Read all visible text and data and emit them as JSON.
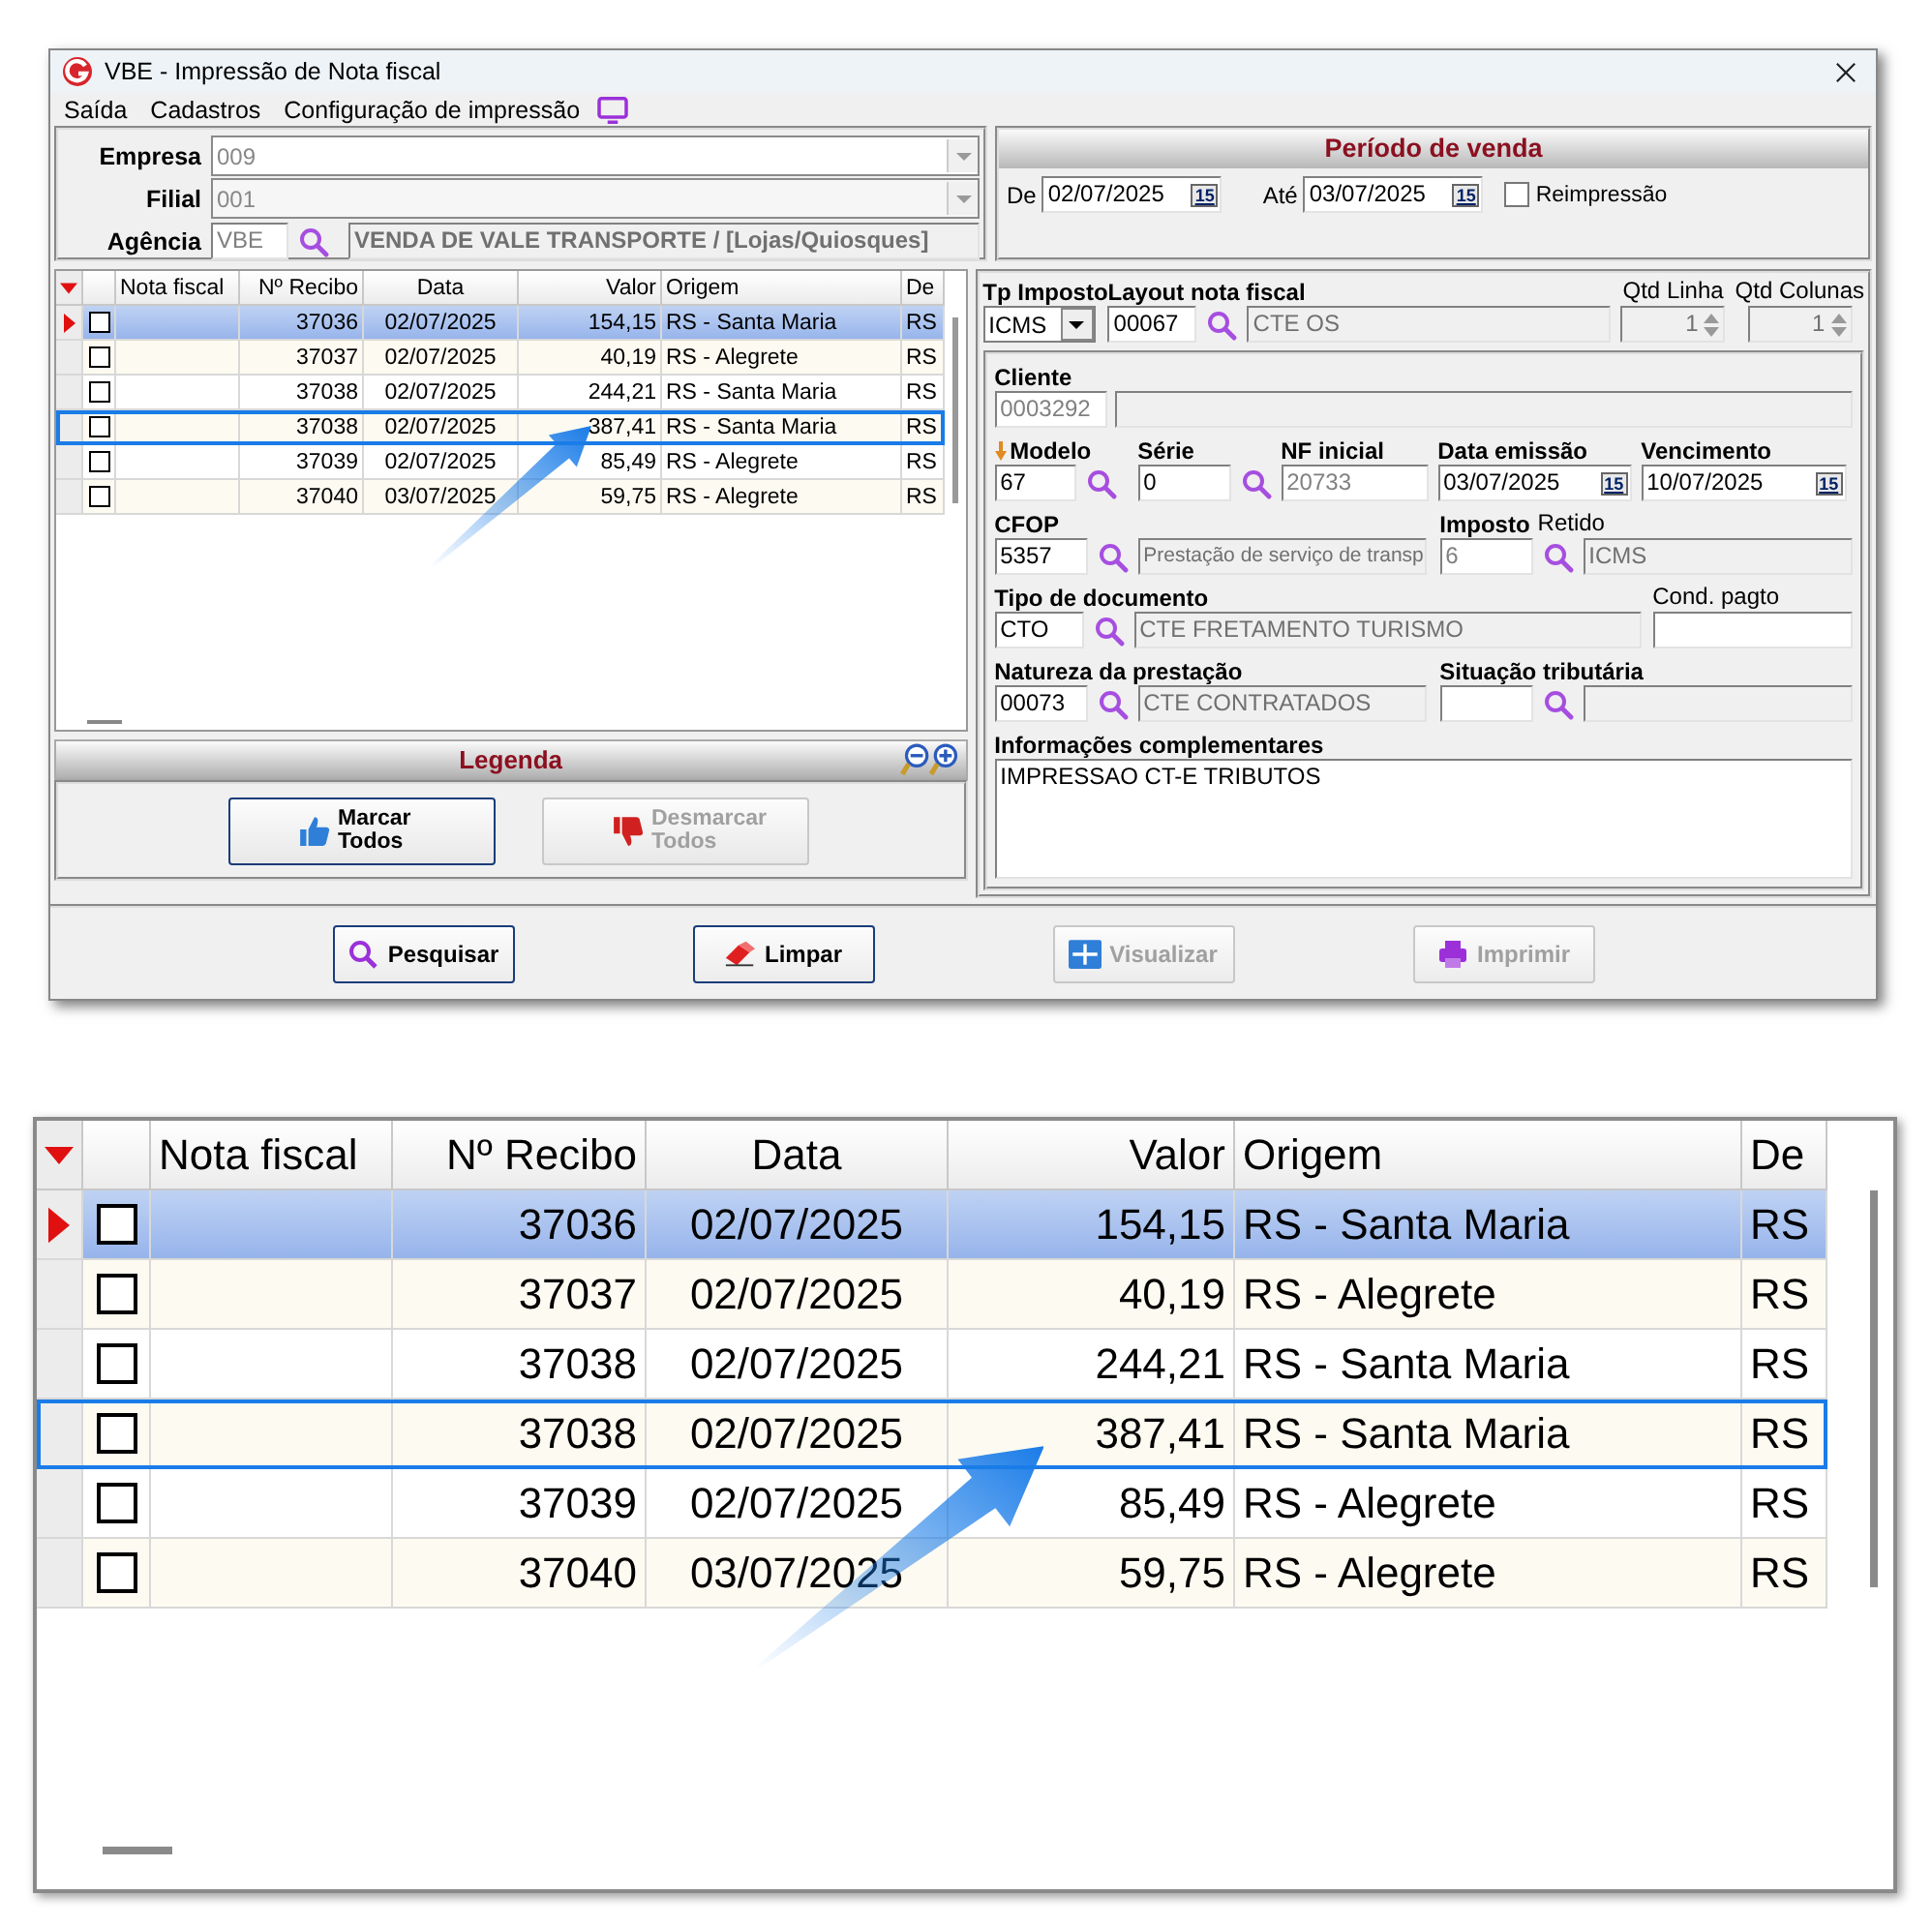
{
  "window": {
    "title": "VBE - Impressão de Nota fiscal"
  },
  "menu": [
    {
      "label": "Saída"
    },
    {
      "label": "Cadastros"
    },
    {
      "label": "Configuração de impressão"
    }
  ],
  "filters": {
    "empresa": {
      "label": "Empresa",
      "value": "009"
    },
    "filial": {
      "label": "Filial",
      "value": "001"
    },
    "agencia": {
      "label": "Agência",
      "code": "VBE",
      "description": "VENDA DE VALE TRANSPORTE / [Lojas/Quiosques]"
    }
  },
  "period": {
    "title": "Período de venda",
    "from": {
      "label": "De",
      "value": "02/07/2025",
      "button": "15"
    },
    "to": {
      "label": "Até",
      "value": "03/07/2025",
      "button": "15"
    },
    "reprint": {
      "label": "Reimpressão",
      "checked": false
    }
  },
  "grid": {
    "columns": [
      "Nota fiscal",
      "Nº Recibo",
      "Data",
      "Valor",
      "Origem",
      "De"
    ],
    "rows": [
      {
        "selected": true,
        "checked": false,
        "highlighted": false,
        "cells": [
          "",
          "37036",
          "02/07/2025",
          "154,15",
          "RS - Santa Maria",
          "RS"
        ]
      },
      {
        "selected": false,
        "checked": false,
        "highlighted": false,
        "cells": [
          "",
          "37037",
          "02/07/2025",
          "40,19",
          "RS - Alegrete",
          "RS"
        ]
      },
      {
        "selected": false,
        "checked": false,
        "highlighted": false,
        "cells": [
          "",
          "37038",
          "02/07/2025",
          "244,21",
          "RS - Santa Maria",
          "RS"
        ]
      },
      {
        "selected": false,
        "checked": false,
        "highlighted": true,
        "cells": [
          "",
          "37038",
          "02/07/2025",
          "387,41",
          "RS - Santa Maria",
          "RS"
        ]
      },
      {
        "selected": false,
        "checked": false,
        "highlighted": false,
        "cells": [
          "",
          "37039",
          "02/07/2025",
          "85,49",
          "RS - Alegrete",
          "RS"
        ]
      },
      {
        "selected": false,
        "checked": false,
        "highlighted": false,
        "cells": [
          "",
          "37040",
          "03/07/2025",
          "59,75",
          "RS - Alegrete",
          "RS"
        ]
      }
    ]
  },
  "legend": {
    "title": "Legenda",
    "buttons": [
      {
        "label": "Marcar Todos",
        "disabled": false
      },
      {
        "label": "Desmarcar Todos",
        "disabled": true
      }
    ]
  },
  "invoice": {
    "tax_type": {
      "label": "Tp Imposto",
      "value": "ICMS"
    },
    "layout": {
      "label": "Layout nota fiscal",
      "code": "00067",
      "description": "CTE OS"
    },
    "qtd_linha": {
      "label": "Qtd Linha",
      "value": "1"
    },
    "qtd_colunas": {
      "label": "Qtd Colunas",
      "value": "1"
    },
    "cliente": {
      "label": "Cliente",
      "code": "0003292"
    },
    "modelo": {
      "label": "Modelo",
      "value": "67"
    },
    "serie": {
      "label": "Série",
      "value": "0"
    },
    "nf_inicial": {
      "label": "NF inicial",
      "value": "20733"
    },
    "data_emissao": {
      "label": "Data emissão",
      "value": "03/07/2025",
      "button": "15"
    },
    "vencimento": {
      "label": "Vencimento",
      "value": "10/07/2025",
      "button": "15"
    },
    "cfop": {
      "label": "CFOP",
      "code": "5357",
      "description": "Prestação de serviço de transp"
    },
    "imposto": {
      "label": "Imposto",
      "label_2": "Retido",
      "code": "6",
      "description": "ICMS"
    },
    "tipo_documento": {
      "label": "Tipo de documento",
      "code": "CTO",
      "description": "CTE FRETAMENTO TURISMO"
    },
    "cond_pagto": {
      "label": "Cond. pagto"
    },
    "natureza": {
      "label": "Natureza da prestação",
      "code": "00073",
      "description": "CTE CONTRATADOS"
    },
    "situacao": {
      "label": "Situação tributária"
    },
    "info": {
      "label": "Informações complementares",
      "value": "IMPRESSAO CT-E TRIBUTOS"
    }
  },
  "actions": [
    {
      "label": "Pesquisar",
      "kind": "search",
      "disabled": false
    },
    {
      "label": "Limpar",
      "kind": "clear",
      "disabled": false
    },
    {
      "label": "Visualizar",
      "kind": "preview",
      "disabled": true
    },
    {
      "label": "Imprimir",
      "kind": "print",
      "disabled": true
    }
  ],
  "inset": {
    "columns": [
      "Nota fiscal",
      "Nº Recibo",
      "Data",
      "Valor",
      "Origem",
      "De"
    ],
    "rows": [
      {
        "selected": true,
        "checked": false,
        "highlighted": false,
        "cells": [
          "",
          "37036",
          "02/07/2025",
          "154,15",
          "RS - Santa Maria",
          "RS"
        ]
      },
      {
        "selected": false,
        "checked": false,
        "highlighted": false,
        "cells": [
          "",
          "37037",
          "02/07/2025",
          "40,19",
          "RS - Alegrete",
          "RS"
        ]
      },
      {
        "selected": false,
        "checked": false,
        "highlighted": false,
        "cells": [
          "",
          "37038",
          "02/07/2025",
          "244,21",
          "RS - Santa Maria",
          "RS"
        ]
      },
      {
        "selected": false,
        "checked": false,
        "highlighted": true,
        "cells": [
          "",
          "37038",
          "02/07/2025",
          "387,41",
          "RS - Santa Maria",
          "RS"
        ]
      },
      {
        "selected": false,
        "checked": false,
        "highlighted": false,
        "cells": [
          "",
          "37039",
          "02/07/2025",
          "85,49",
          "RS - Alegrete",
          "RS"
        ]
      },
      {
        "selected": false,
        "checked": false,
        "highlighted": false,
        "cells": [
          "",
          "37040",
          "03/07/2025",
          "59,75",
          "RS - Alegrete",
          "RS"
        ]
      }
    ]
  }
}
